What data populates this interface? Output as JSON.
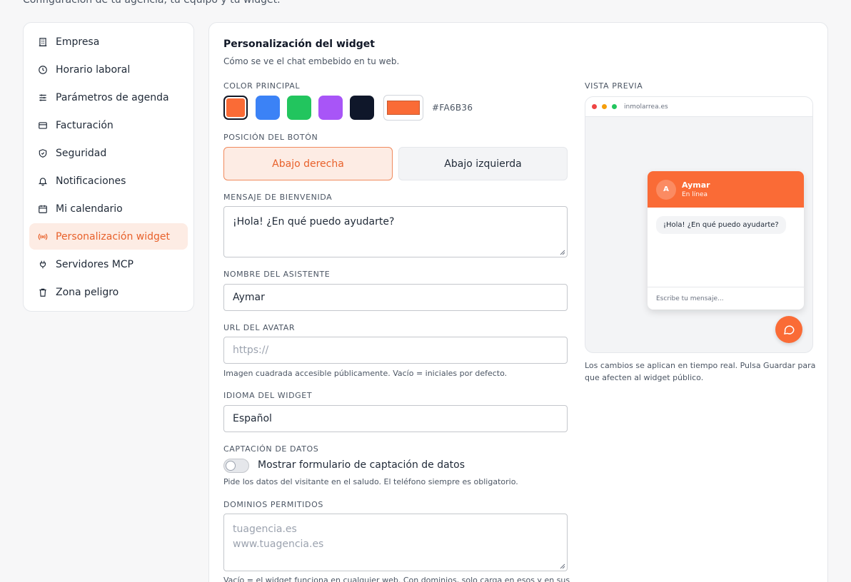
{
  "header": {
    "subtitle": "Configuración de tu agencia, tu equipo y tu widget."
  },
  "sidebar": {
    "items": [
      {
        "label": "Empresa",
        "icon": "building-icon"
      },
      {
        "label": "Horario laboral",
        "icon": "clock-icon"
      },
      {
        "label": "Parámetros de agenda",
        "icon": "sliders-icon"
      },
      {
        "label": "Facturación",
        "icon": "credit-card-icon"
      },
      {
        "label": "Seguridad",
        "icon": "shield-icon"
      },
      {
        "label": "Notificaciones",
        "icon": "bell-icon"
      },
      {
        "label": "Mi calendario",
        "icon": "calendar-icon"
      },
      {
        "label": "Personalización widget",
        "icon": "radio-icon",
        "active": true
      },
      {
        "label": "Servidores MCP",
        "icon": "plug-icon"
      },
      {
        "label": "Zona peligro",
        "icon": "trash-icon"
      }
    ]
  },
  "widget": {
    "title": "Personalización del widget",
    "subtitle": "Cómo se ve el chat embebido en tu web.",
    "color": {
      "label": "Color principal",
      "swatches": [
        "#FA6B36",
        "#3B82F6",
        "#22C55E",
        "#A855F7",
        "#0F172A"
      ],
      "selected": "#FA6B36",
      "hex_label": "#FA6B36"
    },
    "position": {
      "label": "Posición del botón",
      "options": [
        "Abajo derecha",
        "Abajo izquierda"
      ],
      "selected": "Abajo derecha"
    },
    "welcome": {
      "label": "Mensaje de bienvenida",
      "value": "¡Hola! ¿En qué puedo ayudarte?"
    },
    "assistant": {
      "label": "Nombre del asistente",
      "value": "Aymar"
    },
    "avatar": {
      "label": "URL del avatar",
      "placeholder": "https://",
      "help": "Imagen cuadrada accesible públicamente. Vacío = iniciales por defecto."
    },
    "language": {
      "label": "Idioma del widget",
      "value": "Español"
    },
    "capture": {
      "label": "Captación de datos",
      "toggle_label": "Mostrar formulario de captación de datos",
      "enabled": false,
      "help": "Pide los datos del visitante en el saludo. El teléfono siempre es obligatorio."
    },
    "domains": {
      "label": "Dominios permitidos",
      "placeholder_line1": "tuagencia.es",
      "placeholder_line2": "www.tuagencia.es",
      "help": "Vacío = el widget funciona en cualquier web. Con dominios, solo carga en esos y en sus"
    }
  },
  "preview": {
    "label": "Vista previa",
    "url": "inmolarrea.es",
    "avatar_initial": "A",
    "name": "Aymar",
    "status": "En línea",
    "message": "¡Hola! ¿En qué puedo ayudarte?",
    "input_placeholder": "Escribe tu mensaje...",
    "help": "Los cambios se aplican en tiempo real. Pulsa Guardar para que afecten al widget público."
  }
}
